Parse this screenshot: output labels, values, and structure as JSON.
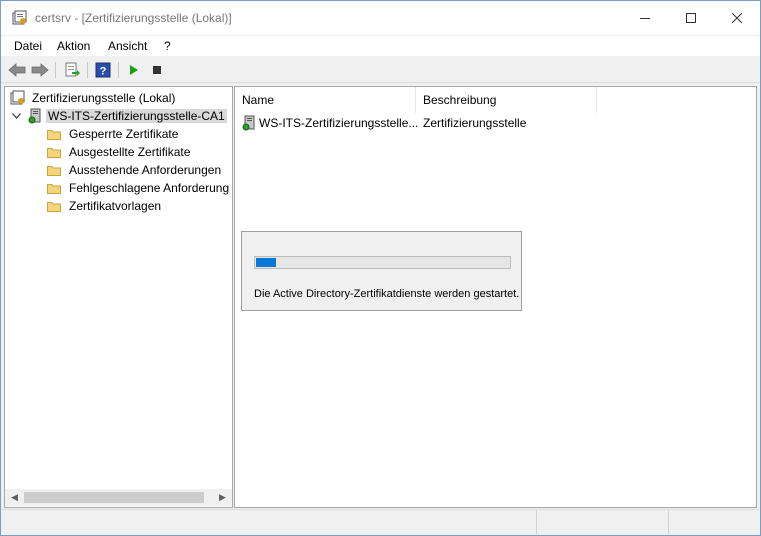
{
  "window": {
    "title": "certsrv - [Zertifizierungsstelle (Lokal)]"
  },
  "menu": {
    "items": [
      "Datei",
      "Aktion",
      "Ansicht",
      "?"
    ]
  },
  "toolbar": {
    "icons": [
      "back-arrow-icon",
      "forward-arrow-icon",
      "export-list-icon",
      "help-icon",
      "start-service-icon",
      "stop-service-icon"
    ]
  },
  "tree": {
    "root": "Zertifizierungsstelle (Lokal)",
    "ca": "WS-ITS-Zertifizierungsstelle-CA1",
    "folders": [
      "Gesperrte Zertifikate",
      "Ausgestellte Zertifikate",
      "Ausstehende Anforderungen",
      "Fehlgeschlagene Anforderung",
      "Zertifikatvorlagen"
    ]
  },
  "list": {
    "columns": [
      "Name",
      "Beschreibung"
    ],
    "rows": [
      {
        "name": "WS-ITS-Zertifizierungsstelle...",
        "description": "Zertifizierungsstelle"
      }
    ]
  },
  "progress": {
    "value_fraction": 0.08,
    "message": "Die Active Directory-Zertifikatdienste werden gestartet."
  },
  "colors": {
    "accent": "#0a78d7",
    "start_green": "#1aa01a"
  }
}
